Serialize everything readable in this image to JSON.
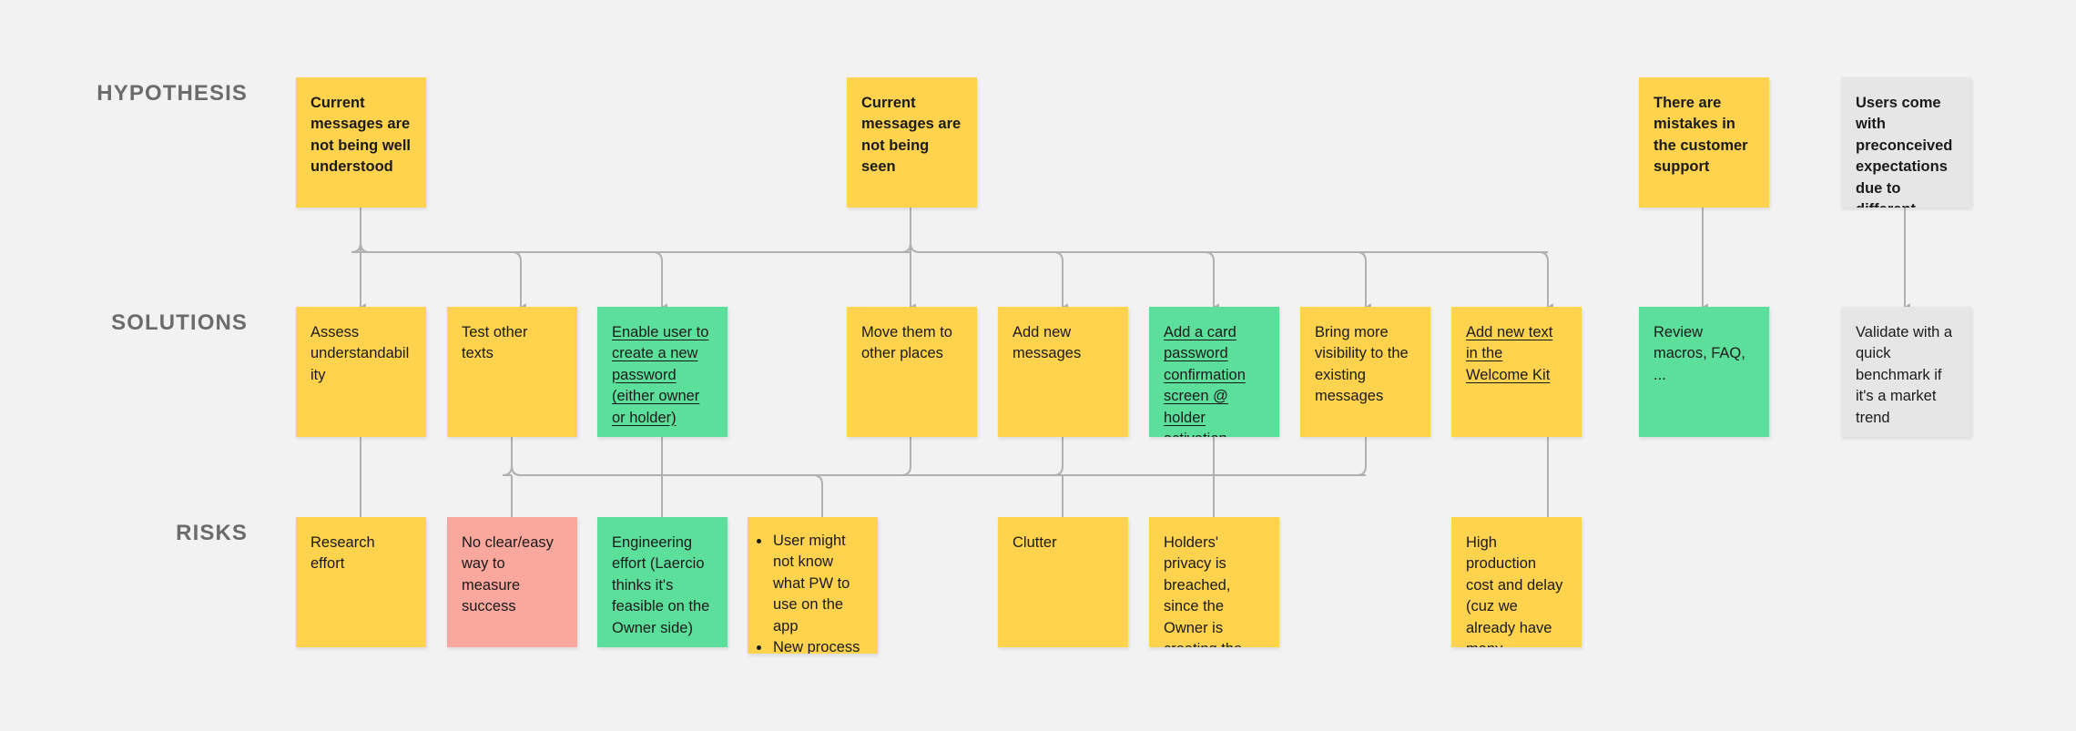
{
  "board": {
    "background_color": "#f2f2f2",
    "connector_color": "#b0b0b0"
  },
  "colors": {
    "yellow": "#ffd34e",
    "green": "#5ddf9c",
    "red": "#faa79e",
    "gray": "#e6e6e6",
    "label": "#6b6b6b",
    "text": "#1a1a1a"
  },
  "rows": [
    {
      "id": "hypothesis",
      "label": "HYPOTHESIS"
    },
    {
      "id": "solutions",
      "label": "SOLUTIONS"
    },
    {
      "id": "risks",
      "label": "RISKS"
    }
  ],
  "hypothesis_cards": [
    {
      "id": "h1",
      "text": "Current messages are not being well understood",
      "color": "yellow",
      "bold": true,
      "underline": false
    },
    {
      "id": "h2",
      "text": "Current messages are not being seen",
      "color": "yellow",
      "bold": true,
      "underline": false
    },
    {
      "id": "h3",
      "text": "There are mistakes in the customer support",
      "color": "yellow",
      "bold": true,
      "underline": false
    },
    {
      "id": "h4",
      "text": "Users come with preconceived expectations due to different approaches from competitors",
      "color": "gray",
      "bold": true,
      "underline": false
    }
  ],
  "solution_cards": [
    {
      "id": "s1",
      "text": "Assess understandability",
      "color": "yellow",
      "bold": false,
      "underline": false
    },
    {
      "id": "s2",
      "text": "Test other texts",
      "color": "yellow",
      "bold": false,
      "underline": false
    },
    {
      "id": "s3",
      "text": "Enable user to create a new password (either owner or holder)",
      "color": "green",
      "bold": false,
      "underline": true
    },
    {
      "id": "s4",
      "text": "Move them to other places",
      "color": "yellow",
      "bold": false,
      "underline": false
    },
    {
      "id": "s5",
      "text": "Add new messages",
      "color": "yellow",
      "bold": false,
      "underline": false
    },
    {
      "id": "s6",
      "text": "Add a card password confirmation screen @ holder activation",
      "color": "green",
      "bold": false,
      "underline": true
    },
    {
      "id": "s7",
      "text": "Bring more visibility to the existing messages",
      "color": "yellow",
      "bold": false,
      "underline": false
    },
    {
      "id": "s8",
      "text": "Add new text in the Welcome Kit",
      "color": "yellow",
      "bold": false,
      "underline": true
    },
    {
      "id": "s9",
      "text": "Review macros, FAQ, ...",
      "color": "green",
      "bold": false,
      "underline": false
    },
    {
      "id": "s10",
      "text": "Validate with a quick benchmark if it's a market trend",
      "color": "gray",
      "bold": false,
      "underline": false
    }
  ],
  "risk_cards": [
    {
      "id": "r1",
      "text": "Research effort",
      "color": "yellow",
      "bold": false,
      "underline": false
    },
    {
      "id": "r2",
      "text": "No clear/easy way to measure success",
      "color": "red",
      "bold": false,
      "underline": false
    },
    {
      "id": "r3",
      "text": "Engineering effort (Laercio thinks it's feasible on the Owner side)",
      "color": "green",
      "bold": false,
      "underline": false
    },
    {
      "id": "r4",
      "color": "yellow",
      "bold": false,
      "underline": false,
      "bullets": [
        "User might not know what PW to use on the app",
        "New process for ops"
      ]
    },
    {
      "id": "r5",
      "text": "Clutter",
      "color": "yellow",
      "bold": false,
      "underline": false
    },
    {
      "id": "r6",
      "text": "Holders' privacy is breached, since the Owner is creating the password",
      "color": "yellow",
      "bold": false,
      "underline": false
    },
    {
      "id": "r7",
      "text": "High production cost and delay (cuz we already have many printed...)",
      "color": "yellow",
      "bold": false,
      "underline": false
    }
  ]
}
